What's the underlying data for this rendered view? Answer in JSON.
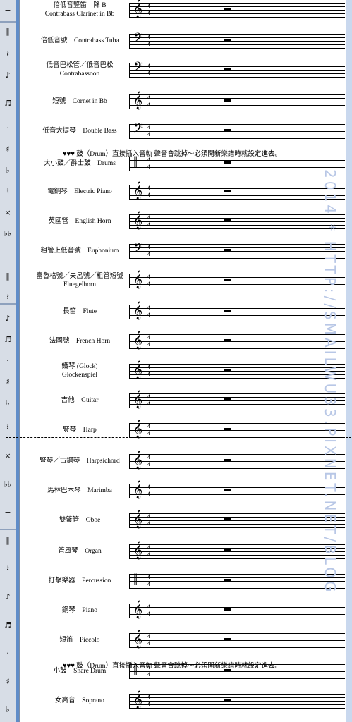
{
  "toolbar": {
    "buttons": [
      {
        "name": "minus-icon",
        "glyph": "−"
      },
      {
        "name": "double-bar-icon",
        "glyph": "‖"
      },
      {
        "name": "rest-icon",
        "glyph": "𝄽"
      },
      {
        "name": "eighth-note-icon",
        "glyph": "♪"
      },
      {
        "name": "sixteenth-note-icon",
        "glyph": "♬"
      },
      {
        "name": "dot-icon",
        "glyph": "·"
      },
      {
        "name": "sharp-icon",
        "glyph": "♯"
      },
      {
        "name": "flat-icon",
        "glyph": "♭"
      },
      {
        "name": "natural-icon",
        "glyph": "♮"
      },
      {
        "name": "double-sharp-icon",
        "glyph": "×"
      },
      {
        "name": "double-flat-icon",
        "glyph": "♭♭"
      }
    ]
  },
  "instruments": [
    {
      "label": "倍低音豎笛　降 B\nContrabass Clarinet in Bb",
      "clef": "𝄞"
    },
    {
      "label": "倍低音號　Contrabass Tuba",
      "clef": "𝄢"
    },
    {
      "label": "低音巴松管／低音巴松\nContrabassoon",
      "clef": "𝄢"
    },
    {
      "label": "短號　Cornet in Bb",
      "clef": "𝄞"
    },
    {
      "label": "低音大提琴　Double Bass",
      "clef": "𝄢"
    },
    {
      "label": "大小鼓／爵士鼓　Drums",
      "clef": "‖"
    },
    {
      "label": "電鋼琴　Electric Piano",
      "clef": "𝄞"
    },
    {
      "label": "英國管　English Horn",
      "clef": "𝄞"
    },
    {
      "label": "粗管上低音號　Euphonium",
      "clef": "𝄢"
    },
    {
      "label": "富魯格號／夫呂號／粗管短號\nFluegelhorn",
      "clef": "𝄞"
    },
    {
      "label": "長笛　Flute",
      "clef": "𝄞"
    },
    {
      "label": "法國號　French Horn",
      "clef": "𝄞"
    },
    {
      "label": "鐵琴 (Glock)\nGlockenspiel",
      "clef": "𝄞"
    },
    {
      "label": "吉他　Guitar",
      "clef": "𝄞"
    },
    {
      "label": "豎琴　Harp",
      "clef": "𝄞"
    },
    {
      "label": "豎琴／古鋼琴　Harpsichord",
      "clef": "𝄞"
    },
    {
      "label": "馬林巴木琴　Marimba",
      "clef": "𝄞"
    },
    {
      "label": "雙簧管　Oboe",
      "clef": "𝄞"
    },
    {
      "label": "管風琴　Organ",
      "clef": "𝄞"
    },
    {
      "label": "打擊樂器　Percussion",
      "clef": "‖"
    },
    {
      "label": "鋼琴　Piano",
      "clef": "𝄞"
    },
    {
      "label": "短笛　Piccolo",
      "clef": "𝄞"
    },
    {
      "label": "小鼓　Snare Drum",
      "clef": "‖"
    },
    {
      "label": "女高音　Soprano",
      "clef": "𝄞"
    }
  ],
  "notes": {
    "drums_note": "♥♥♥ 鼓（Drum）直接插入音軌 聲音會跳掉～必須開新樂譜時就設定進去。",
    "snare_note": "♥♥♥ 鼓（Drum）直接插入音軌 聲音會跳掉～必須開新樂譜時就設定進去。"
  },
  "time_signature": {
    "top": "4",
    "bottom": "4"
  },
  "watermark": "2014 * HTTP://SMAILWU33.PIXNET.NET/BLOG"
}
